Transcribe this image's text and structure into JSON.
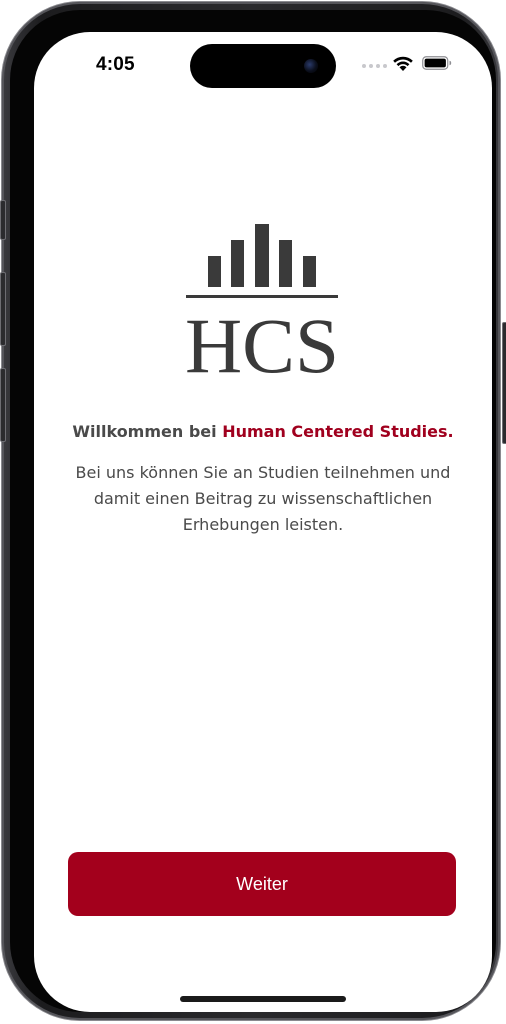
{
  "status_bar": {
    "time": "4:05",
    "icons": [
      "signal-dots-icon",
      "wifi-icon",
      "battery-icon"
    ]
  },
  "logo": {
    "text": "HCS",
    "color": "#3a3a3a"
  },
  "welcome": {
    "prefix": "Willkommen bei ",
    "brand": "Human Centered Studies."
  },
  "description": "Bei uns können Sie an Studien teilnehmen und damit einen Beitrag zu wissenschaftlichen Erhebungen leisten.",
  "continue_button": {
    "label": "Weiter"
  },
  "colors": {
    "accent": "#a3001c",
    "text": "#4a4a4a"
  }
}
